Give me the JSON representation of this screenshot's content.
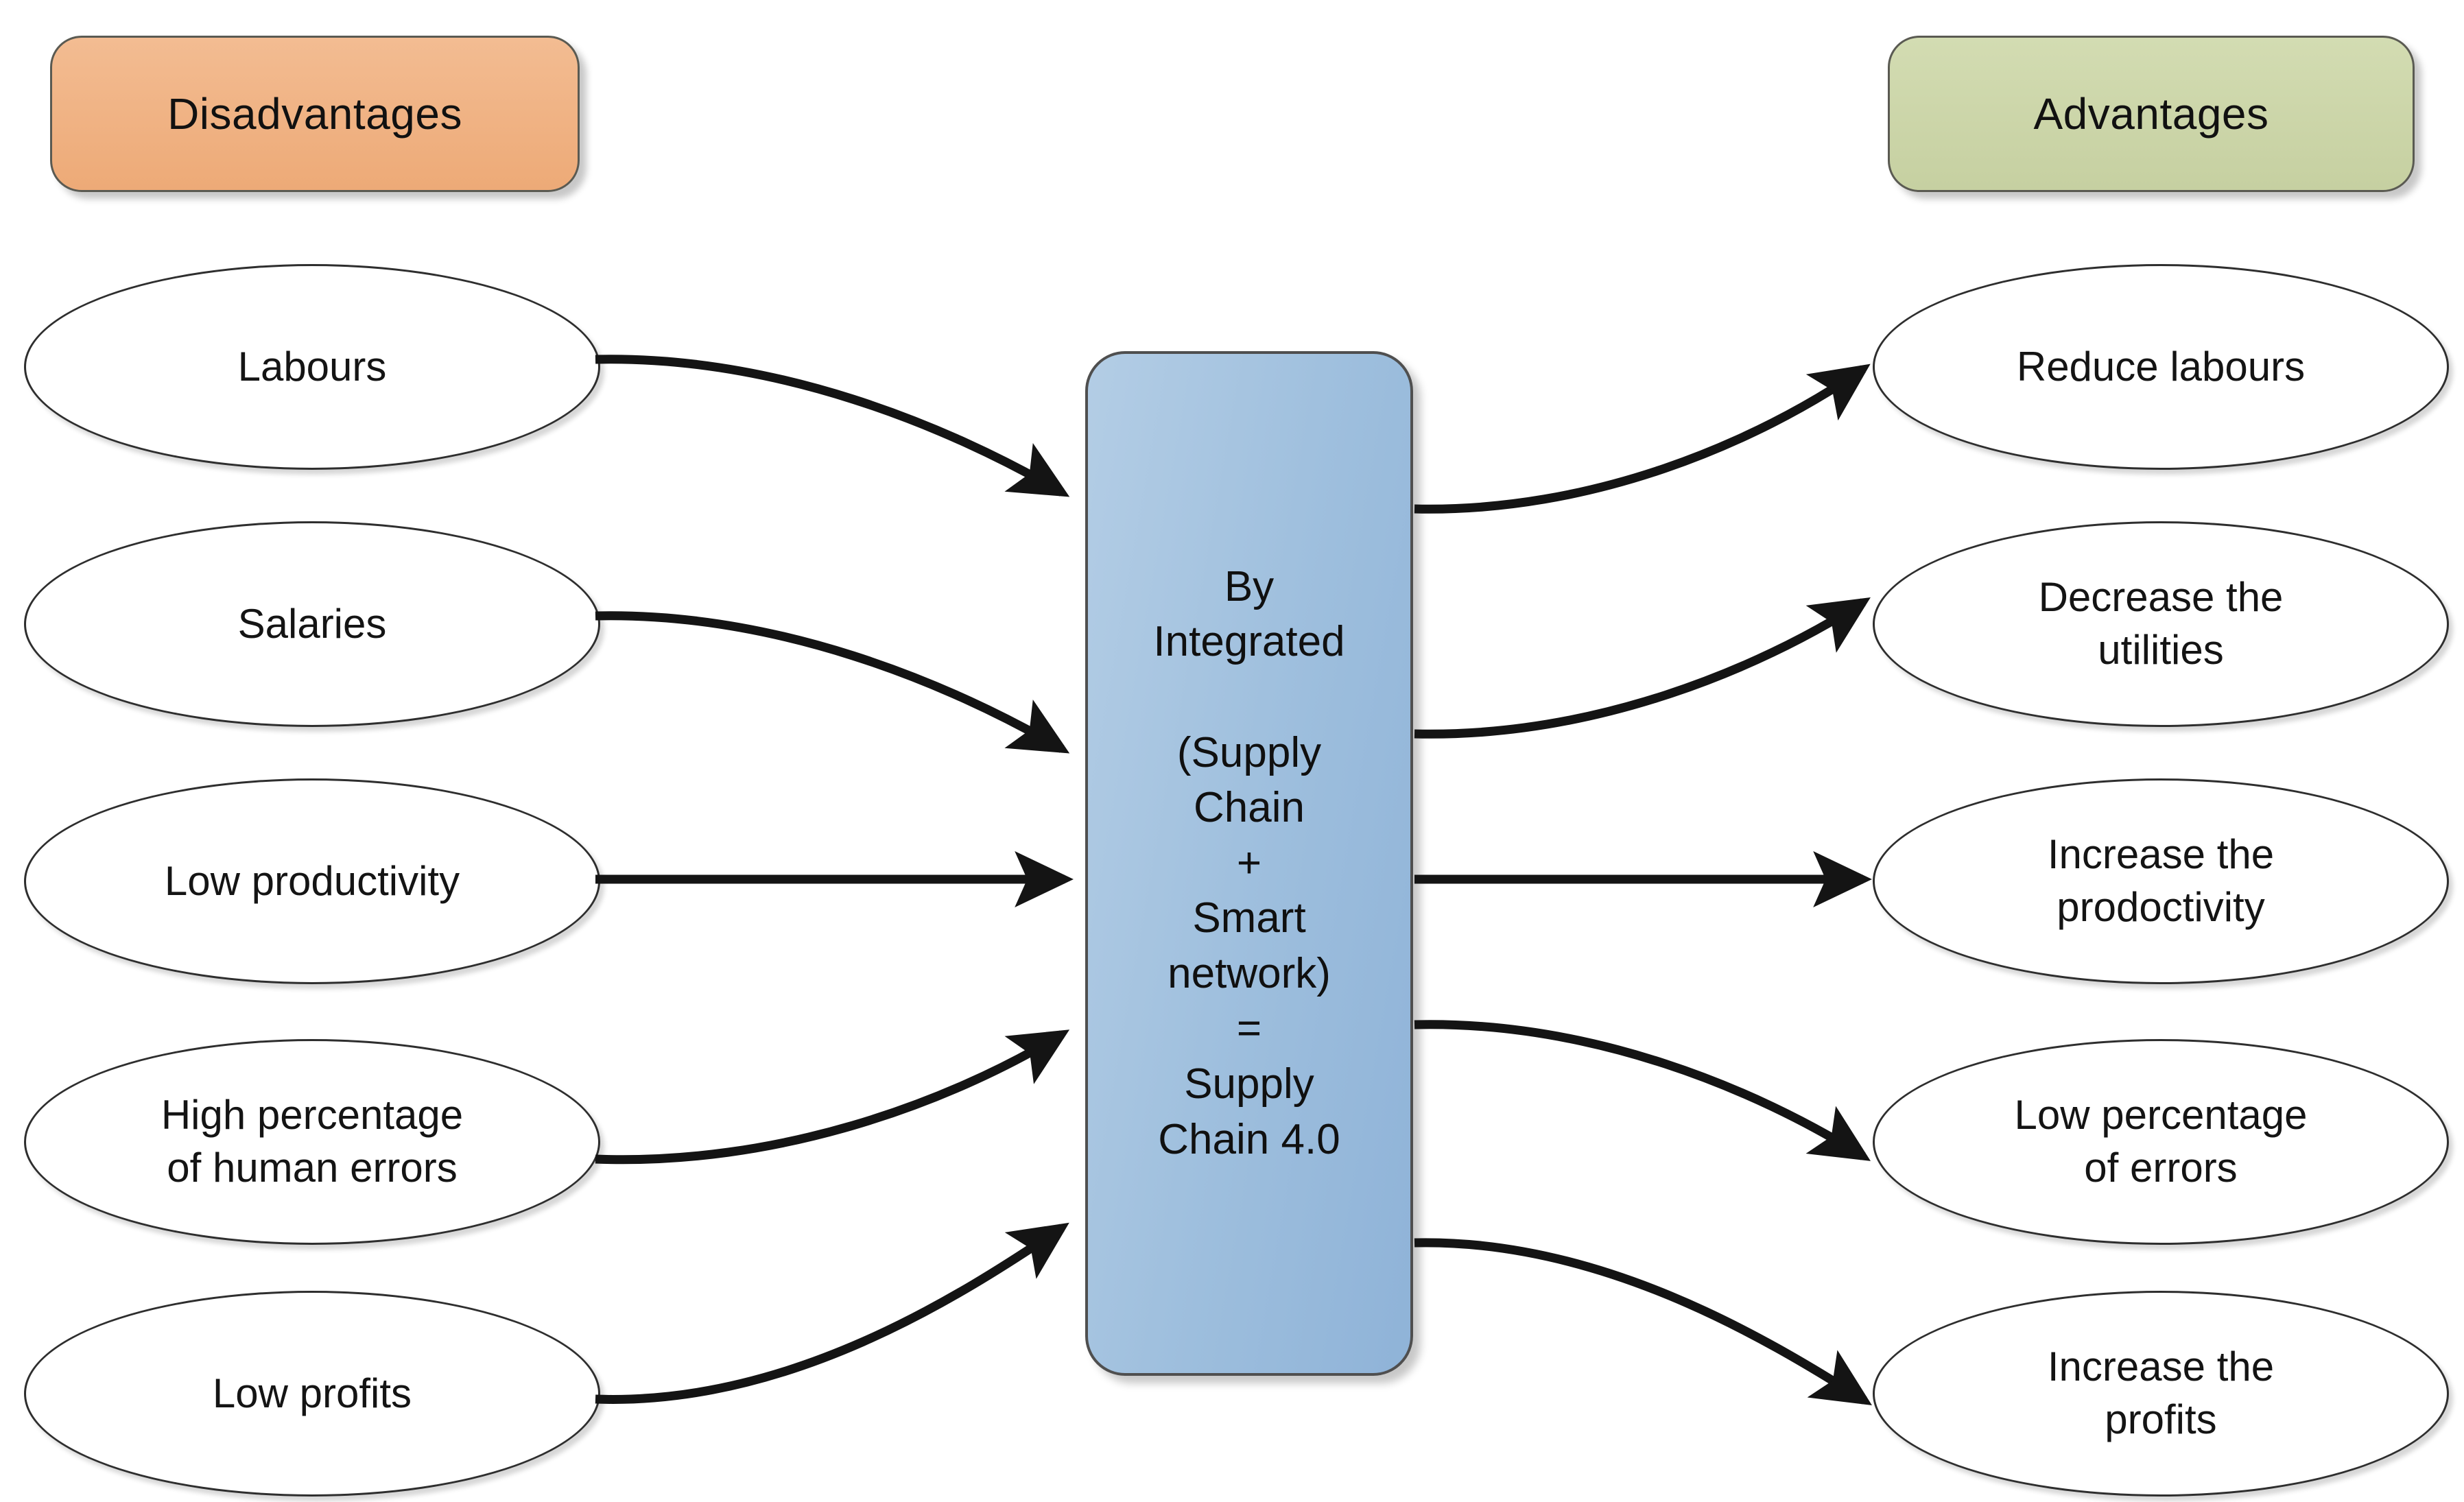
{
  "diagram": {
    "title_left": "Disadvantages",
    "title_right": "Advantages",
    "center": {
      "text": "By\nIntegrated\n\n(Supply\nChain\n+\nSmart\nnetwork)\n=\nSupply\nChain 4.0"
    },
    "colors": {
      "disadvantages_fill": "#edaa77",
      "advantages_fill": "#c6d0a1",
      "center_fill": "#9dbedd",
      "node_fill": "#ffffff",
      "stroke": "#141414",
      "background": "#ffffff"
    },
    "left_nodes": [
      {
        "label": "Labours"
      },
      {
        "label": "Salaries"
      },
      {
        "label": "Low productivity"
      },
      {
        "label": "High percentage\nof human errors"
      },
      {
        "label": "Low profits"
      }
    ],
    "right_nodes": [
      {
        "label": "Reduce labours"
      },
      {
        "label": "Decrease the\nutilities"
      },
      {
        "label": "Increase the\nprodoctivity"
      },
      {
        "label": "Low percentage\nof errors"
      },
      {
        "label": "Increase the\nprofits"
      }
    ],
    "edges": [
      {
        "from": "Labours",
        "to": "By Integrated (Supply Chain + Smart network) = Supply Chain 4.0",
        "shape": "curved-down"
      },
      {
        "from": "Salaries",
        "to": "By Integrated (Supply Chain + Smart network) = Supply Chain 4.0",
        "shape": "curved-down"
      },
      {
        "from": "Low productivity",
        "to": "By Integrated (Supply Chain + Smart network) = Supply Chain 4.0",
        "shape": "straight"
      },
      {
        "from": "High percentage of human errors",
        "to": "By Integrated (Supply Chain + Smart network) = Supply Chain 4.0",
        "shape": "curved-up"
      },
      {
        "from": "Low profits",
        "to": "By Integrated (Supply Chain + Smart network) = Supply Chain 4.0",
        "shape": "curved-up"
      },
      {
        "from": "By Integrated (Supply Chain + Smart network) = Supply Chain 4.0",
        "to": "Reduce labours",
        "shape": "curved-up"
      },
      {
        "from": "By Integrated (Supply Chain + Smart network) = Supply Chain 4.0",
        "to": "Decrease the utilities",
        "shape": "curved-up"
      },
      {
        "from": "By Integrated (Supply Chain + Smart network) = Supply Chain 4.0",
        "to": "Increase the prodoctivity",
        "shape": "straight"
      },
      {
        "from": "By Integrated (Supply Chain + Smart network) = Supply Chain 4.0",
        "to": "Low percentage of errors",
        "shape": "curved-down"
      },
      {
        "from": "By Integrated (Supply Chain + Smart network) = Supply Chain 4.0",
        "to": "Increase the profits",
        "shape": "curved-down"
      }
    ]
  }
}
